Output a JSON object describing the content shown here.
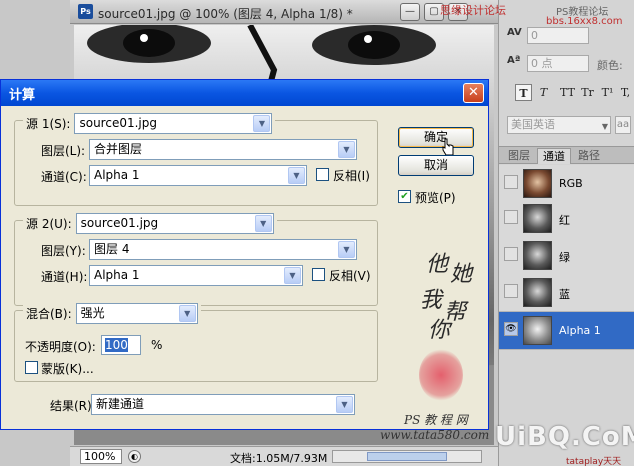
{
  "document": {
    "ps_badge": "Ps",
    "title": "source01.jpg @ 100% (图层 4, Alpha 1/8) *",
    "zoom": "100%",
    "status": "文档:1.05M/7.93M"
  },
  "char_panel": {
    "tracking_value": "0",
    "baseline_value": "0 点",
    "color_label": "颜色:",
    "tt_buttons": [
      "T",
      "T",
      "TT",
      "Tr",
      "T¹",
      "T,"
    ],
    "language": "美国英语",
    "aa_label": "aa"
  },
  "channels_panel": {
    "tabs": [
      "图层",
      "通道",
      "路径"
    ],
    "active_tab": "通道",
    "channels": [
      {
        "name": "RGB",
        "selected": false
      },
      {
        "name": "红",
        "selected": false
      },
      {
        "name": "绿",
        "selected": false
      },
      {
        "name": "蓝",
        "selected": false
      },
      {
        "name": "Alpha 1",
        "selected": true
      }
    ]
  },
  "dialog": {
    "title": "计算",
    "source1": {
      "legend": "源 1(S):",
      "file": "source01.jpg",
      "layer_label": "图层(L):",
      "layer": "合并图层",
      "channel_label": "通道(C):",
      "channel": "Alpha 1",
      "invert_label": "反相(I)"
    },
    "source2": {
      "legend": "源 2(U):",
      "file": "source01.jpg",
      "layer_label": "图层(Y):",
      "layer": "图层 4",
      "channel_label": "通道(H):",
      "channel": "Alpha 1",
      "invert_label": "反相(V)"
    },
    "blend": {
      "legend": "混合(B):",
      "mode": "强光",
      "opacity_label": "不透明度(O):",
      "opacity_value": "100",
      "opacity_unit": "%",
      "mask_label": "蒙版(K)..."
    },
    "result_label": "结果(R):",
    "result": "新建通道",
    "ok_label": "确定",
    "cancel_label": "取消",
    "preview_label": "预览(P)",
    "preview_checked": true
  },
  "watermark": {
    "calligraphy": [
      "他",
      "她",
      "我",
      "帮",
      "你"
    ],
    "site_name": "PS 教 程 网",
    "site_url": "www.tata580.com",
    "brand": "UiBQ.CoM",
    "brand_sub": "tataplay天天",
    "top_text": "思缘设计论坛",
    "top_text2": "PS教程论坛",
    "top_text3": "bbs.16xx8.com"
  }
}
